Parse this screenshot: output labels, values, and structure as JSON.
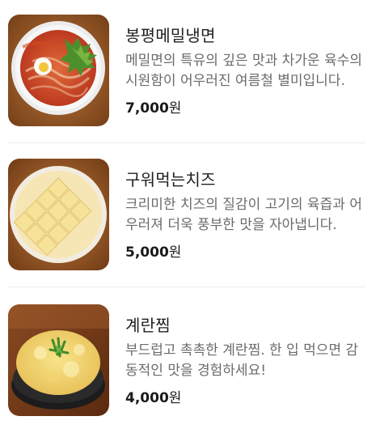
{
  "menu": {
    "items": [
      {
        "name": "봉평메밀냉면",
        "description": "메밀면의 특유의 깊은 맛과 차가운 육수의 시원함이 어우러진 여름철 별미입니다.",
        "price": "7,000",
        "currency": "원"
      },
      {
        "name": "구워먹는치즈",
        "description": "크리미한 치즈의 질감이 고기의 육즙과 어우러져 더욱 풍부한 맛을 자아냅니다.",
        "price": "5,000",
        "currency": "원"
      },
      {
        "name": "계란찜",
        "description": "부드럽고 촉촉한 계란찜. 한 입 먹으면 감동적인 맛을 경험하세요!",
        "price": "4,000",
        "currency": "원"
      }
    ]
  }
}
